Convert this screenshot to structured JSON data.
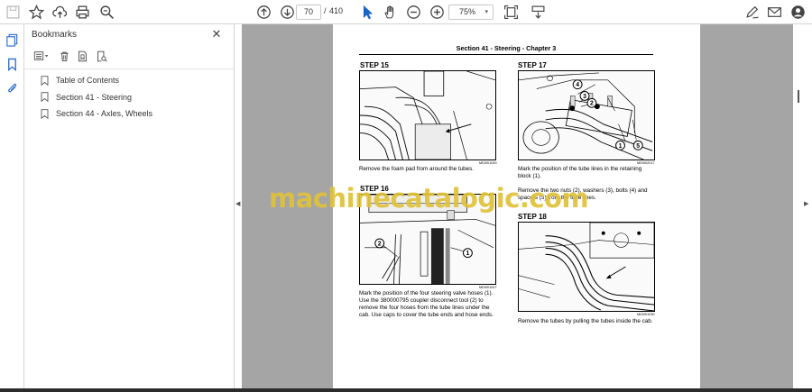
{
  "toolbar": {
    "page_current": "70",
    "page_separator": "/",
    "page_total": "410",
    "zoom": "75%"
  },
  "bookmarks": {
    "title": "Bookmarks",
    "items": [
      {
        "label": "Table of Contents"
      },
      {
        "label": "Section 41 - Steering"
      },
      {
        "label": "Section 44 - Axles, Wheels"
      }
    ]
  },
  "document": {
    "section_title": "Section 41 - Steering - Chapter 3",
    "steps": [
      {
        "label": "STEP  15",
        "code": "MD00I1049",
        "caption": "Remove the foam pad from around the tubes."
      },
      {
        "label": "STEP  17",
        "code": "MD00I2017",
        "caption": "Mark the position of the tube lines in the retaining block (1).",
        "caption2": "Remove the two nuts (2), washers (3), bolts (4) and spacers (5) from the tube lines."
      },
      {
        "label": "STEP  16",
        "code": "MD00I1027",
        "caption": "Mark the position of the four steering valve hoses (1). Use the 380000795 coupler disconnect tool (2) to remove the four hoses from the tube lines under the cab. Use caps to cover the tube ends and hose ends."
      },
      {
        "label": "STEP  18",
        "code": "MD00I1030",
        "caption": "Remove the tubes by pulling the tubes inside the cab."
      }
    ],
    "watermark": "machinecatalogic.com"
  }
}
